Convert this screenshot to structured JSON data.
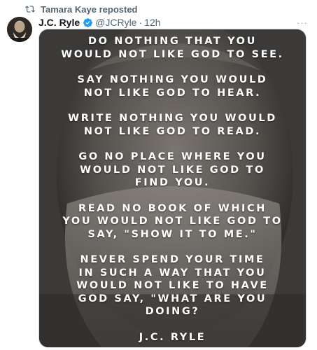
{
  "repost": {
    "label": "Tamara Kaye reposted",
    "icon": "repost-icon"
  },
  "author": {
    "display_name": "J.C. Ryle",
    "verified": true,
    "verified_color": "#1d9bf0",
    "handle": "@JCRyle",
    "separator": "·",
    "time": "12h"
  },
  "more_label": "···",
  "media": {
    "lines": [
      [
        "DO NOTHING THAT YOU",
        "WOULD NOT LIKE GOD TO SEE."
      ],
      [
        "SAY NOTHING YOU WOULD",
        "NOT LIKE GOD TO HEAR."
      ],
      [
        "WRITE NOTHING YOU WOULD",
        "NOT LIKE GOD TO READ."
      ],
      [
        "GO NO PLACE WHERE YOU",
        "WOULD NOT LIKE GOD TO",
        "FIND YOU."
      ],
      [
        "READ NO BOOK OF WHICH",
        "YOU WOULD NOT LIKE GOD TO",
        "SAY, \"SHOW IT TO ME.\""
      ],
      [
        "NEVER SPEND YOUR TIME",
        "IN SUCH A WAY THAT YOU",
        "WOULD NOT LIKE TO HAVE",
        "GOD SAY, \"WHAT ARE YOU",
        "DOING?"
      ]
    ],
    "signature": "J.C. RYLE"
  }
}
